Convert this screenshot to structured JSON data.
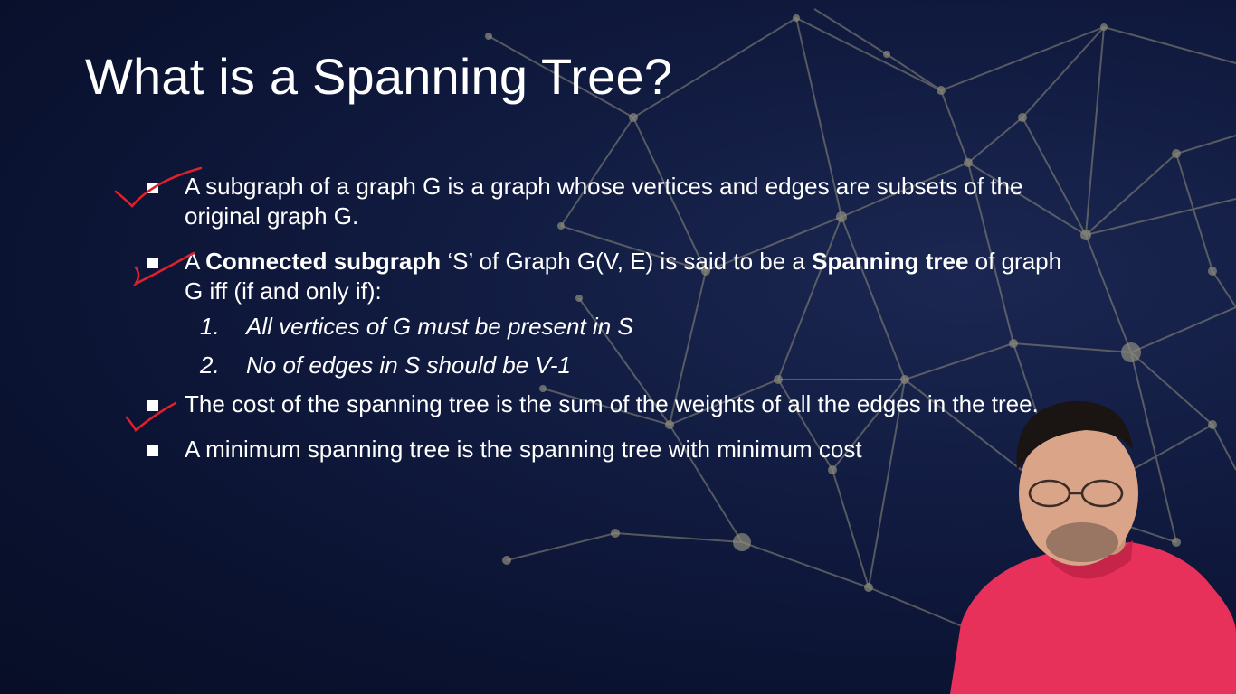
{
  "slide": {
    "title": "What is a Spanning Tree?",
    "bullets": [
      {
        "text": "A subgraph of a graph G is a graph whose vertices and edges are subsets of the original graph G."
      },
      {
        "prefix": "A ",
        "bold1": "Connected subgraph",
        "middle": " ‘S’ of Graph G(V, E) is said to be a ",
        "bold2": "Spanning tree",
        "suffix": " of graph G iff (if and only if):",
        "subitems": [
          {
            "num": "1.",
            "text": "All vertices of G must be present in S"
          },
          {
            "num": "2.",
            "text": "No of edges in S should be V-1"
          }
        ]
      },
      {
        "text": "The cost of the spanning tree is the sum of the weights of all the edges in the tree."
      },
      {
        "text": "A minimum spanning tree is the spanning tree with minimum cost"
      }
    ]
  },
  "colors": {
    "background": "#0b1433",
    "text": "#ffffff",
    "network": "#8f8d7c",
    "annotation": "#e0202a",
    "shirt": "#e8315a"
  },
  "icons": {
    "bullet": "square-bullet",
    "annotations": "red-checkmark"
  }
}
